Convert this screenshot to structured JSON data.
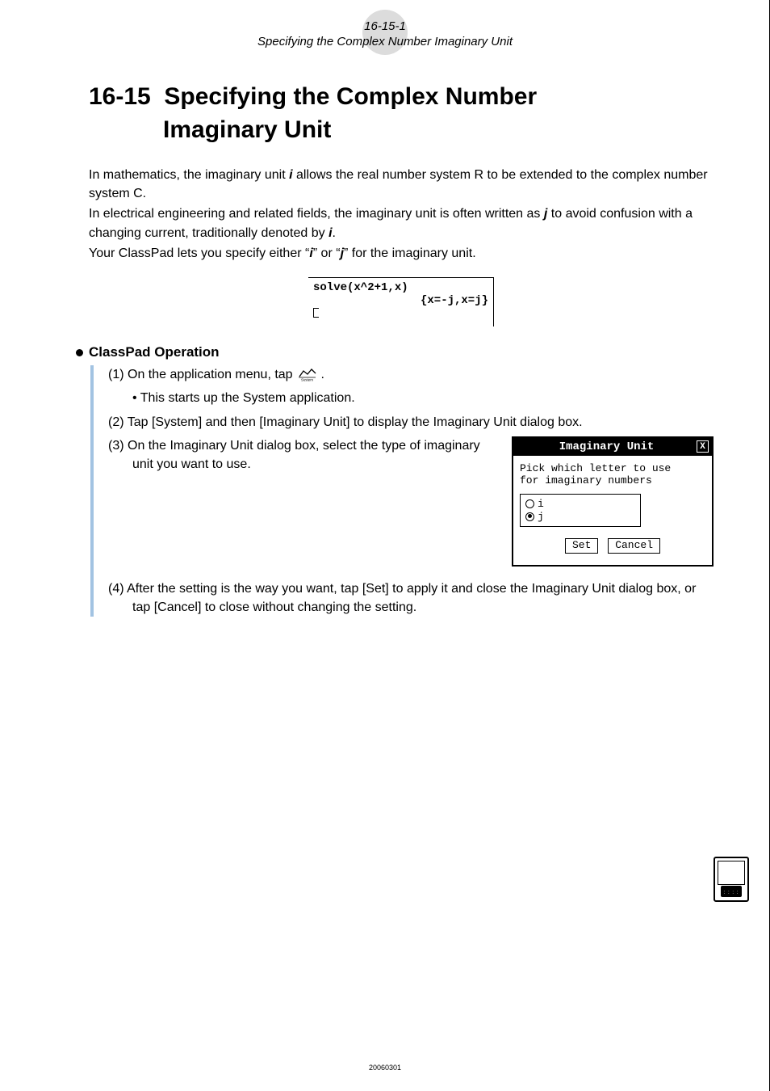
{
  "header": {
    "page_number": "16-15-1",
    "subtitle": "Specifying the Complex Number Imaginary Unit"
  },
  "title": {
    "number": "16-15",
    "text_line1": "Specifying the Complex Number",
    "text_line2": "Imaginary Unit"
  },
  "intro": {
    "p1a": "In mathematics, the imaginary unit ",
    "p1_em1": "i",
    "p1b": " allows the real number system R to be extended to the complex number system C.",
    "p2a": "In electrical engineering and related fields, the imaginary unit is often written as ",
    "p2_em1": "j",
    "p2b": " to avoid confusion with a changing current, traditionally denoted by ",
    "p2_em2": "i",
    "p2c": ".",
    "p3a": "Your ClassPad lets you specify either “",
    "p3_em1": "i",
    "p3b": "” or “",
    "p3_em2": "j",
    "p3c": "” for the imaginary unit."
  },
  "solve_figure": {
    "line1": "solve(x^2+1,x)",
    "line2": "{x=-j,x=j}"
  },
  "operation": {
    "heading": "ClassPad Operation",
    "step1a": "(1) On the application menu, tap ",
    "step1b": ".",
    "step1_sub_bullet": "• ",
    "step1_sub": "This starts up the System application.",
    "step2": "(2) Tap [System] and then [Imaginary Unit] to display the Imaginary Unit dialog box.",
    "step3": "(3) On the Imaginary Unit dialog box, select the type of imaginary unit you want to use.",
    "step4": "(4) After the setting is the way you want, tap [Set] to apply it and close the Imaginary Unit dialog box, or tap [Cancel] to close without changing the setting."
  },
  "dialog": {
    "title": "Imaginary Unit",
    "close_label": "X",
    "prompt_l1": "Pick which letter to use",
    "prompt_l2": "for imaginary numbers",
    "option_i": "i",
    "option_j": "j",
    "btn_set": "Set",
    "btn_cancel": "Cancel"
  },
  "footer": {
    "date": "20060301"
  }
}
